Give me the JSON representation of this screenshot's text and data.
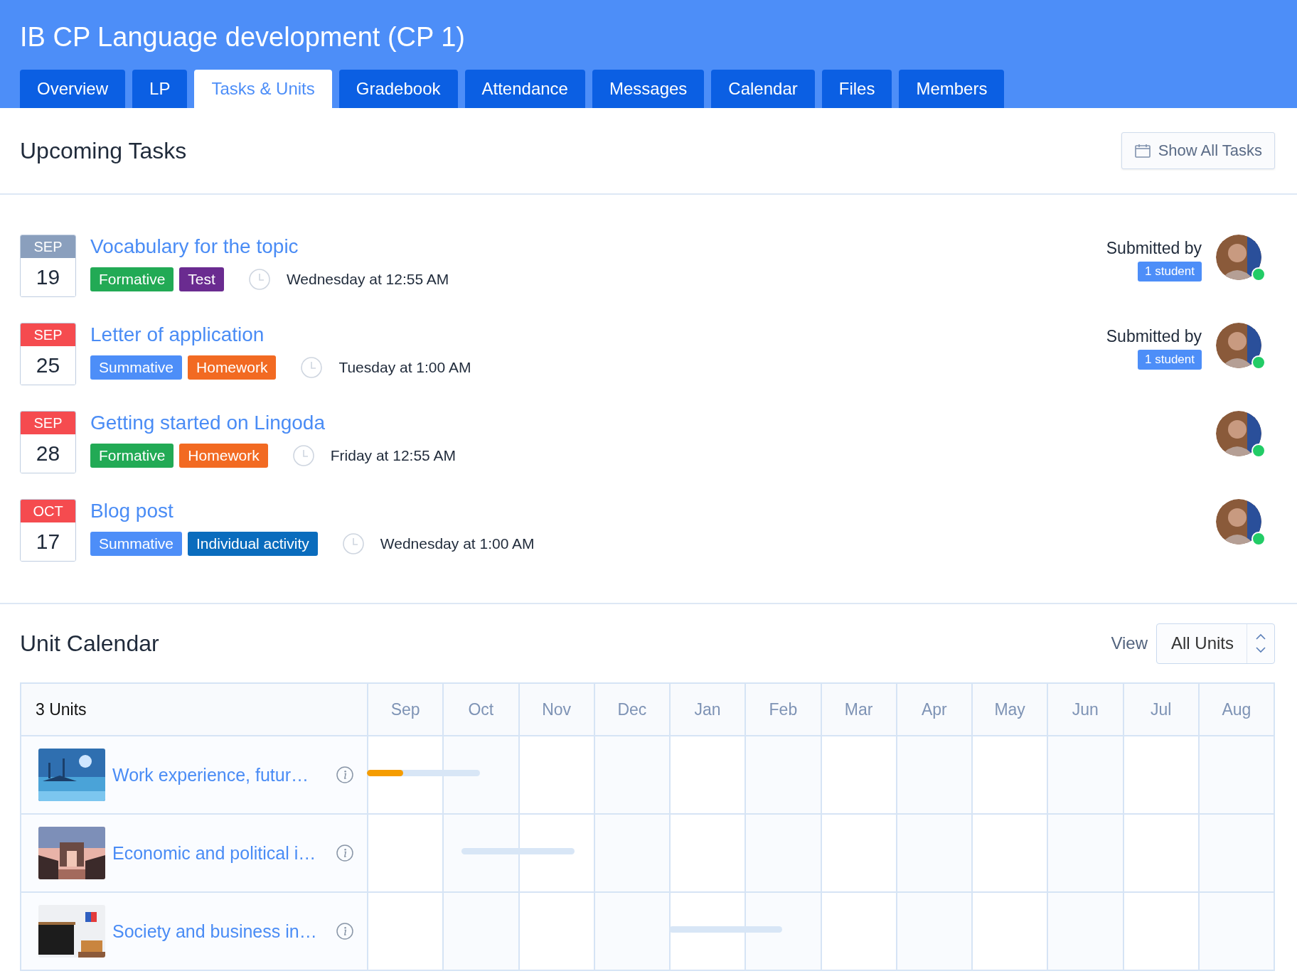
{
  "header": {
    "title": "IB CP Language development (CP 1)"
  },
  "tabs": [
    {
      "label": "Overview",
      "selected": false
    },
    {
      "label": "LP",
      "selected": false
    },
    {
      "label": "Tasks & Units",
      "selected": true
    },
    {
      "label": "Gradebook",
      "selected": false
    },
    {
      "label": "Attendance",
      "selected": false
    },
    {
      "label": "Messages",
      "selected": false
    },
    {
      "label": "Calendar",
      "selected": false
    },
    {
      "label": "Files",
      "selected": false
    },
    {
      "label": "Members",
      "selected": false
    }
  ],
  "upcoming": {
    "title": "Upcoming Tasks",
    "show_all_button": "Show All Tasks",
    "tasks": [
      {
        "month": "SEP",
        "day": "19",
        "color": "#8a9fbd",
        "title": "Vocabulary for the topic",
        "tags": [
          {
            "label": "Formative",
            "color": "#22aa55"
          },
          {
            "label": "Test",
            "color": "#6a2b90"
          }
        ],
        "due": "Wednesday at 12:55 AM",
        "submitted_label": "Submitted by",
        "submitted_count": "1 student",
        "online": true
      },
      {
        "month": "SEP",
        "day": "25",
        "color": "#f54b4f",
        "title": "Letter of application",
        "tags": [
          {
            "label": "Summative",
            "color": "#4d8ef8"
          },
          {
            "label": "Homework",
            "color": "#f26a22"
          }
        ],
        "due": "Tuesday at 1:00 AM",
        "submitted_label": "Submitted by",
        "submitted_count": "1 student",
        "online": true
      },
      {
        "month": "SEP",
        "day": "28",
        "color": "#f54b4f",
        "title": "Getting started on Lingoda",
        "tags": [
          {
            "label": "Formative",
            "color": "#22aa55"
          },
          {
            "label": "Homework",
            "color": "#f26a22"
          }
        ],
        "due": "Friday at 12:55 AM",
        "online": true
      },
      {
        "month": "OCT",
        "day": "17",
        "color": "#f54b4f",
        "title": "Blog post",
        "tags": [
          {
            "label": "Summative",
            "color": "#4d8ef8"
          },
          {
            "label": "Individual activity",
            "color": "#0a6cbd"
          }
        ],
        "due": "Wednesday at 1:00 AM",
        "online": true
      }
    ]
  },
  "unit_calendar": {
    "title": "Unit Calendar",
    "view_label": "View",
    "view_value": "All Units",
    "count_label": "3 Units",
    "months": [
      "Sep",
      "Oct",
      "Nov",
      "Dec",
      "Jan",
      "Feb",
      "Mar",
      "Apr",
      "May",
      "Jun",
      "Jul",
      "Aug"
    ],
    "units": [
      {
        "title": "Work experience, futur…",
        "level": 0.32,
        "timeline": [
          {
            "kind": "full"
          },
          {
            "kind": "head"
          },
          {
            "kind": "none"
          },
          {
            "kind": "none"
          },
          {
            "kind": "none"
          },
          {
            "kind": "none"
          },
          {
            "kind": "none"
          },
          {
            "kind": "none"
          },
          {
            "kind": "none"
          },
          {
            "kind": "none"
          },
          {
            "kind": "none"
          },
          {
            "kind": "none"
          }
        ]
      },
      {
        "title": "Economic and political i…",
        "timeline": [
          {
            "kind": "none"
          },
          {
            "kind": "tail"
          },
          {
            "kind": "lead"
          },
          {
            "kind": "none"
          },
          {
            "kind": "none"
          },
          {
            "kind": "none"
          },
          {
            "kind": "none"
          },
          {
            "kind": "none"
          },
          {
            "kind": "none"
          },
          {
            "kind": "none"
          },
          {
            "kind": "none"
          },
          {
            "kind": "none"
          }
        ]
      },
      {
        "title": "Society and business in…",
        "timeline": [
          {
            "kind": "none"
          },
          {
            "kind": "none"
          },
          {
            "kind": "none"
          },
          {
            "kind": "none"
          },
          {
            "kind": "full"
          },
          {
            "kind": "head"
          },
          {
            "kind": "none"
          },
          {
            "kind": "none"
          },
          {
            "kind": "none"
          },
          {
            "kind": "none"
          },
          {
            "kind": "none"
          },
          {
            "kind": "none"
          }
        ]
      }
    ]
  }
}
